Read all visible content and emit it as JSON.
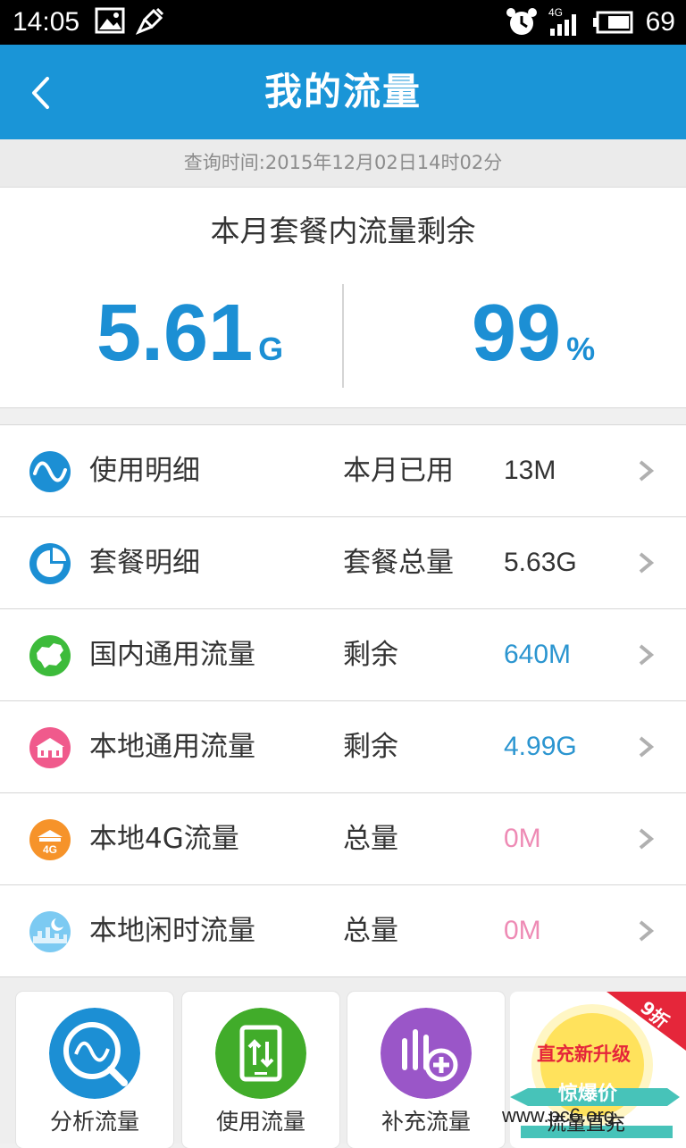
{
  "status_bar": {
    "time": "14:05",
    "network": "4G",
    "battery": "69",
    "icons": [
      "image-icon",
      "broom-icon",
      "alarm-icon",
      "signal-icon",
      "battery-icon"
    ]
  },
  "header": {
    "title": "我的流量"
  },
  "query_time": "查询时间:2015年12月02日14时02分",
  "summary": {
    "title": "本月套餐内流量剩余",
    "remaining_value": "5.61",
    "remaining_unit": "G",
    "percent_value": "99",
    "percent_unit": "%"
  },
  "list": [
    {
      "label": "使用明细",
      "key": "本月已用",
      "value": "13M",
      "value_color": "#333333",
      "icon": "wave-icon",
      "icon_color": "#1c8fd4"
    },
    {
      "label": "套餐明细",
      "key": "套餐总量",
      "value": "5.63G",
      "value_color": "#333333",
      "icon": "pie-chart-icon",
      "icon_color": "#1c8fd4"
    },
    {
      "label": "国内通用流量",
      "key": "剩余",
      "value": "640M",
      "value_color": "#2b95d0",
      "icon": "china-map-icon",
      "icon_color": "#3dbb3b"
    },
    {
      "label": "本地通用流量",
      "key": "剩余",
      "value": "4.99G",
      "value_color": "#2b95d0",
      "icon": "landmark-icon",
      "icon_color": "#f05a8c"
    },
    {
      "label": "本地4G流量",
      "key": "总量",
      "value": "0M",
      "value_color": "#ee8bb5",
      "icon": "4g-badge-icon",
      "icon_color": "#f6932a"
    },
    {
      "label": "本地闲时流量",
      "key": "总量",
      "value": "0M",
      "value_color": "#ee8bb5",
      "icon": "night-city-icon",
      "icon_color": "#7ccaf2"
    }
  ],
  "toolbar": [
    {
      "label": "分析流量",
      "icon": "analyze-icon",
      "color": "#1c8fd4"
    },
    {
      "label": "使用流量",
      "icon": "phone-transfer-icon",
      "color": "#41ac2a"
    },
    {
      "label": "补充流量",
      "icon": "add-data-icon",
      "color": "#9a56c8"
    }
  ],
  "promo": {
    "badge": "9折",
    "line1": "直充新升级",
    "line2": "惊爆价"
  },
  "watermark": "www.pc6.org",
  "watermark2": "流量直充"
}
